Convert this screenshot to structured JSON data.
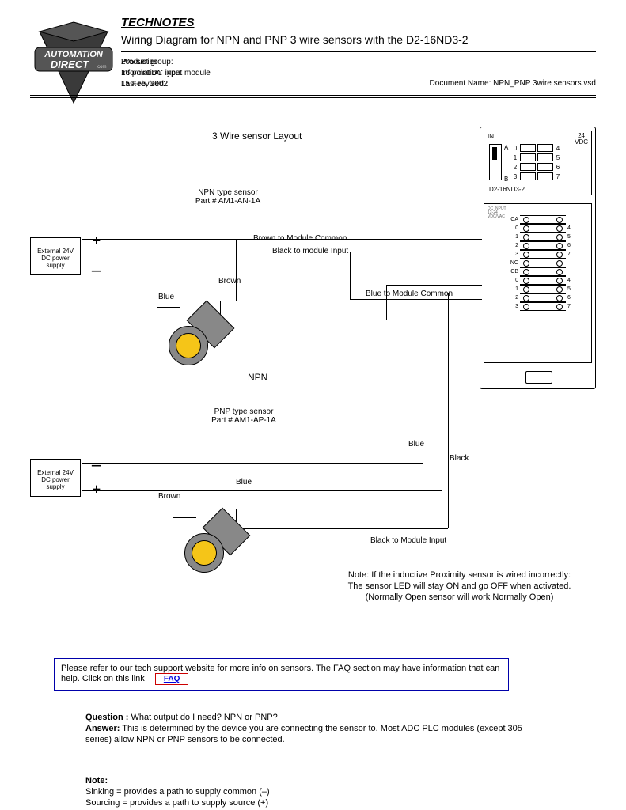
{
  "header": {
    "technotes": "TECHNOTES",
    "title": "Wiring Diagram for NPN and PNP 3 wire sensors with the D2-16ND3-2",
    "meta": {
      "pg_lbl": "Product group:",
      "pg": "205 series",
      "it_lbl": "Information Type:",
      "it": "16 point DC input module",
      "lr_lbl": "Last revised :",
      "lr": "15 Feb, 2002"
    },
    "docname": "Document Name: NPN_PNP 3wire sensors.vsd",
    "logo_top": "AUTOMATION",
    "logo_bot": "DIRECT",
    "logo_com": ".com"
  },
  "diagram": {
    "layout_title": "3 Wire sensor Layout",
    "npn": {
      "heading1": "NPN type sensor",
      "heading2": "Part # AM1-AN-1A",
      "brown_common": "Brown to Module Common",
      "black_input": "Black to module Input",
      "blue_common": "Blue to Module Common",
      "brown": "Brown",
      "blue": "Blue",
      "type": "NPN"
    },
    "pnp": {
      "heading1": "PNP type sensor",
      "heading2": "Part # AM1-AP-1A",
      "blue": "Blue",
      "black": "Black",
      "brown": "Brown",
      "blue2": "Blue",
      "black_input": "Black to Module Input"
    },
    "psu": "External 24V\nDC power\nsupply",
    "module": {
      "in": "IN",
      "vdc1": "24",
      "vdc2": "VDC",
      "a": "A",
      "b": "B",
      "part": "D2-16ND3-2",
      "nums_left": [
        "0",
        "1",
        "2",
        "3"
      ],
      "nums_right": [
        "4",
        "5",
        "6",
        "7"
      ],
      "ca": "CA",
      "cb": "CB",
      "nc": "NC",
      "term_nums": [
        "0",
        "1",
        "2",
        "3",
        "4",
        "5",
        "6",
        "7"
      ]
    },
    "note_incorrect": "Note: If the inductive Proximity sensor is wired incorrectly:\nThe sensor LED will stay ON and go OFF when activated.\n(Normally Open sensor will work Normally Open)"
  },
  "infobox": {
    "text": "Please refer to our tech support website for more info on sensors.  The FAQ section may have information that can help.  Click on this link",
    "faq": "FAQ"
  },
  "qa": {
    "q_lbl": "Question :",
    "q": " What output do I need? NPN or PNP?",
    "a_lbl": "Answer:",
    "a": " This is determined by the device you are connecting the sensor to. Most ADC PLC modules (except 305 series) allow NPN or PNP sensors to be connected."
  },
  "note": {
    "lbl": "Note:",
    "l1": "Sinking = provides a path to supply common (–)",
    "l2": "Sourcing = provides a path to supply source (+)"
  }
}
